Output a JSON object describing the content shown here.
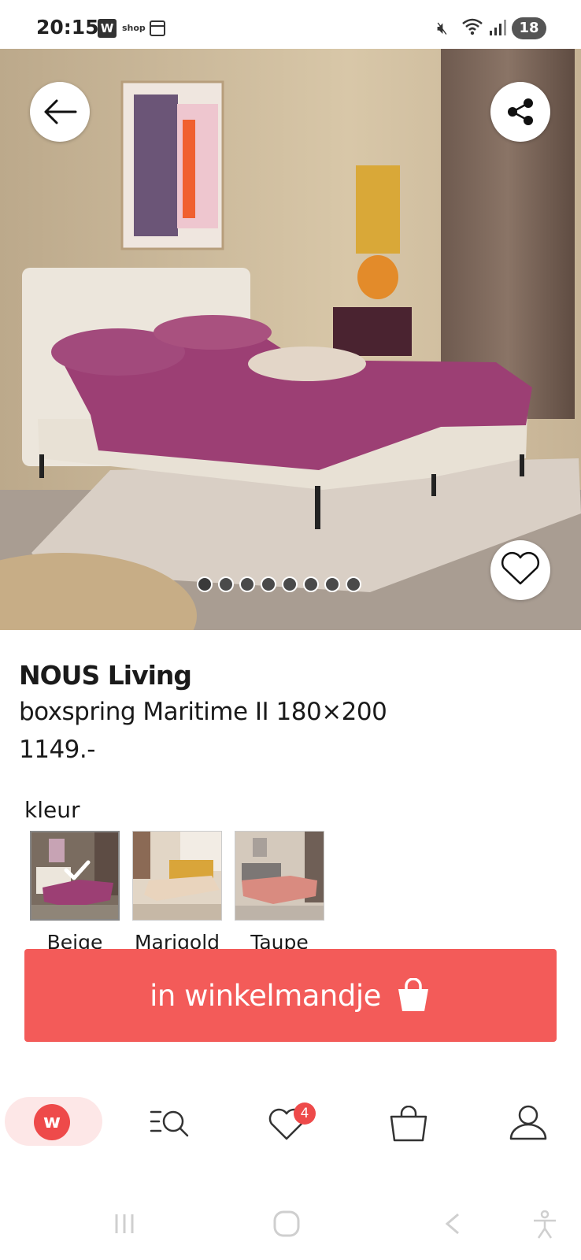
{
  "status_bar": {
    "time": "20:15",
    "app_badge": "W",
    "shop_label": "shop",
    "battery": "18"
  },
  "hero": {
    "image_count": 8,
    "active_index": 0
  },
  "product": {
    "brand": "NOUS Living",
    "name": "boxspring Maritime II 180×200",
    "price": "1149.-"
  },
  "color_section": {
    "label": "kleur",
    "options": [
      {
        "name": "Beige",
        "selected": true
      },
      {
        "name": "Marigold",
        "selected": false
      },
      {
        "name": "Taupe",
        "selected": false
      }
    ]
  },
  "cta": {
    "label": "in winkelmandje",
    "icon": "shopping-bag-icon",
    "color": "#f35b59"
  },
  "bottom_nav": {
    "home_logo": "w",
    "favorites_count": "4",
    "items": [
      "home-icon",
      "search-menu-icon",
      "heart-icon",
      "basket-icon",
      "user-icon"
    ]
  },
  "colors": {
    "accent": "#f35b59",
    "brand_red": "#ee4a4a"
  }
}
